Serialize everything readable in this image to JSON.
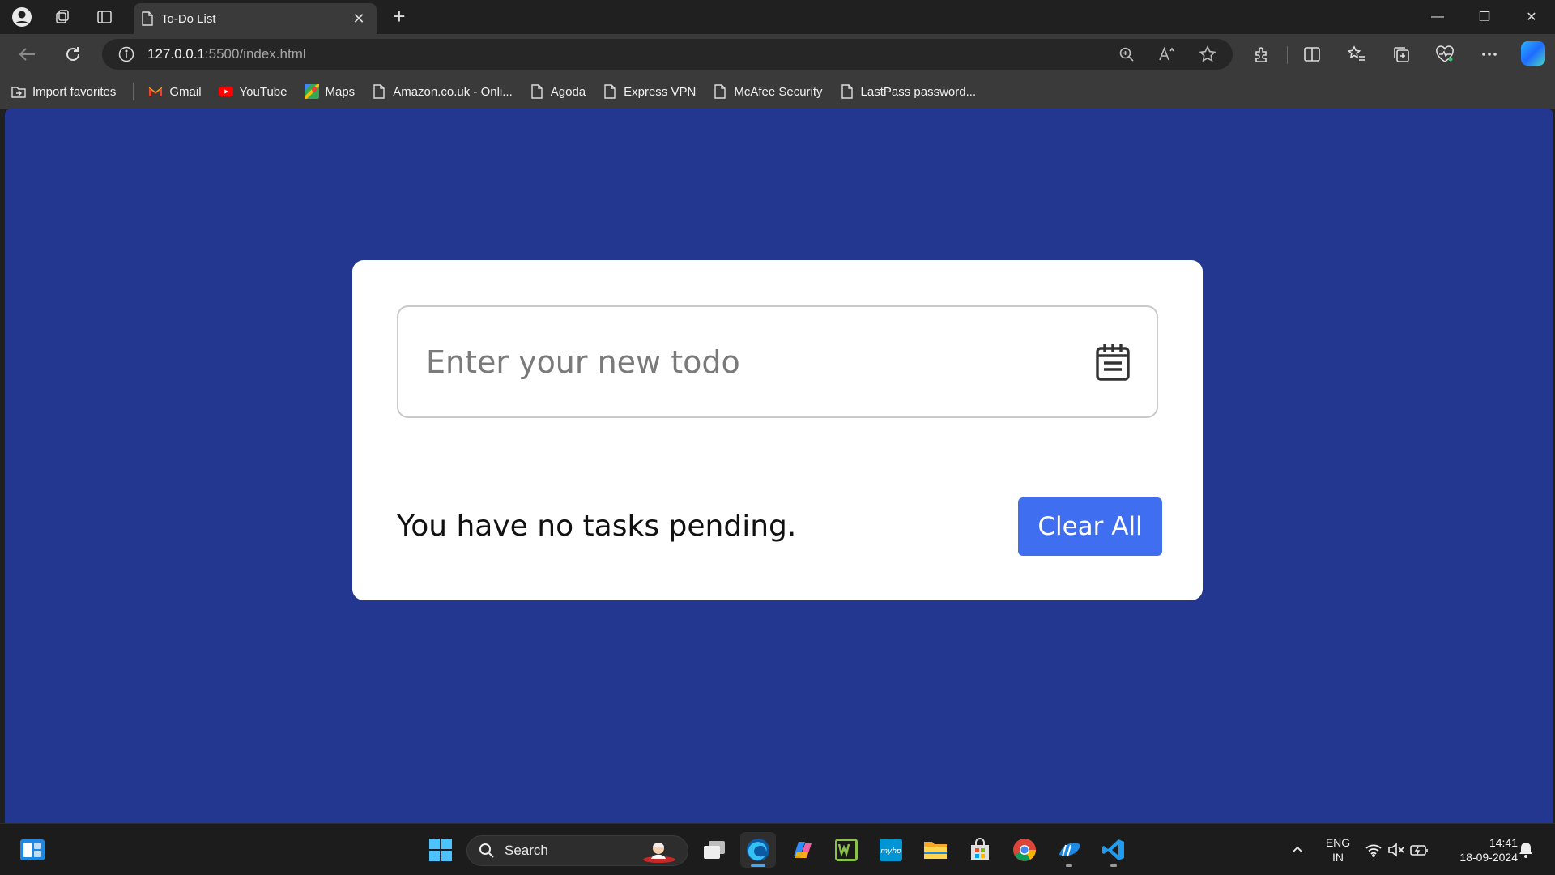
{
  "browser": {
    "tab": {
      "title": "To-Do List",
      "close": "✕"
    },
    "new_tab": "+",
    "window_controls": {
      "minimize": "—",
      "restore": "❐",
      "close": "✕"
    },
    "address": {
      "host": "127.0.0.1",
      "path": ":5500/index.html"
    },
    "favorites": [
      {
        "label": "Import favorites",
        "icon": "import-icon"
      },
      {
        "label": "Gmail",
        "icon": "gmail-icon"
      },
      {
        "label": "YouTube",
        "icon": "youtube-icon"
      },
      {
        "label": "Maps",
        "icon": "maps-icon"
      },
      {
        "label": "Amazon.co.uk - Onli...",
        "icon": "page-icon"
      },
      {
        "label": "Agoda",
        "icon": "page-icon"
      },
      {
        "label": "Express VPN",
        "icon": "page-icon"
      },
      {
        "label": "McAfee Security",
        "icon": "page-icon"
      },
      {
        "label": "LastPass password...",
        "icon": "page-icon"
      }
    ]
  },
  "app": {
    "input_placeholder": "Enter your new todo",
    "input_value": "",
    "pending_text": "You have no tasks pending.",
    "clear_button": "Clear All",
    "colors": {
      "background": "#233690",
      "card": "#ffffff",
      "button": "#3f6ef0"
    }
  },
  "taskbar": {
    "search_label": "Search",
    "language": {
      "line1": "ENG",
      "line2": "IN"
    },
    "time": "14:41",
    "date": "18-09-2024"
  }
}
